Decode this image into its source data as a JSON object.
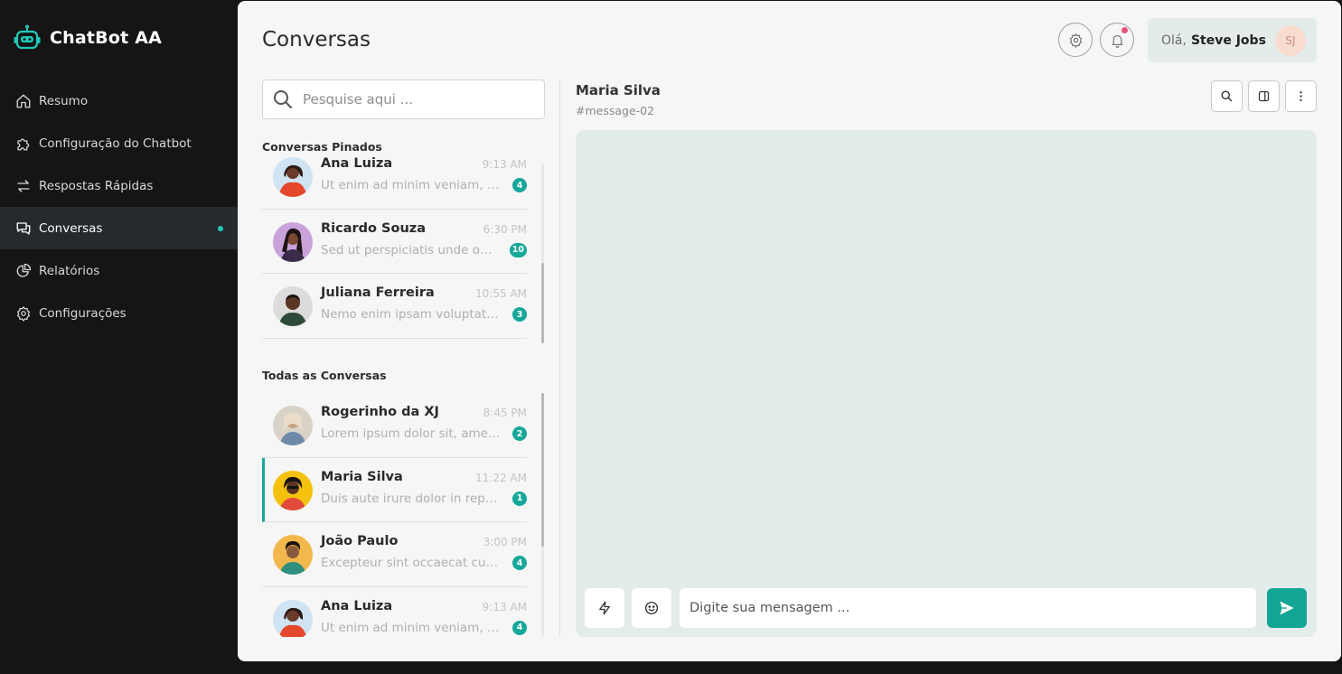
{
  "brand": {
    "name": "ChatBot AA",
    "icon": "robot-icon",
    "accent": "#1ec9b7"
  },
  "nav": {
    "items": [
      {
        "label": "Resumo",
        "icon": "home-icon"
      },
      {
        "label": "Configuração do Chatbot",
        "icon": "puzzle-icon"
      },
      {
        "label": "Respostas Rápidas",
        "icon": "swap-arrows-icon"
      },
      {
        "label": "Conversas",
        "icon": "chat-bubbles-icon",
        "active": true
      },
      {
        "label": "Relatórios",
        "icon": "pie-chart-icon"
      },
      {
        "label": "Configurações",
        "icon": "gear-icon"
      }
    ]
  },
  "header": {
    "title": "Conversas",
    "greeting": "Olá,",
    "user_name": "Steve Jobs",
    "user_initials": "SJ"
  },
  "search": {
    "placeholder": "Pesquise aqui ..."
  },
  "pinned": {
    "title": "Conversas Pinados",
    "items": [
      {
        "name": "Ana Luiza",
        "time": "9:13 AM",
        "preview": "Ut enim ad minim veniam, quis nostrud",
        "badge": "4"
      },
      {
        "name": "Ricardo Souza",
        "time": "6:30 PM",
        "preview": "Sed ut perspiciatis unde omnis iste",
        "badge": "10"
      },
      {
        "name": "Juliana Ferreira",
        "time": "10:55 AM",
        "preview": "Nemo enim ipsam voluptatem quia",
        "badge": "3"
      }
    ]
  },
  "all": {
    "title": "Todas as Conversas",
    "items": [
      {
        "name": "Rogerinho da XJ",
        "time": "8:45 PM",
        "preview": "Lorem ipsum dolor sit, amet consectetur",
        "badge": "2"
      },
      {
        "name": "Maria Silva",
        "time": "11:22 AM",
        "preview": "Duis aute irure dolor in reprehenderit",
        "badge": "1",
        "selected": true
      },
      {
        "name": "João Paulo",
        "time": "3:00 PM",
        "preview": "Excepteur sint occaecat cupidatat",
        "badge": "4"
      },
      {
        "name": "Ana Luiza",
        "time": "9:13 AM",
        "preview": "Ut enim ad minim veniam, quis nostrud",
        "badge": "4"
      }
    ]
  },
  "chat": {
    "name": "Maria Silva",
    "channel": "#message-02",
    "input_placeholder": "Digite sua mensagem ..."
  },
  "colors": {
    "accent": "#15a89a",
    "sidebar_bg": "#151515",
    "chat_bg": "#e2ecea",
    "notification": "#e5527a"
  }
}
